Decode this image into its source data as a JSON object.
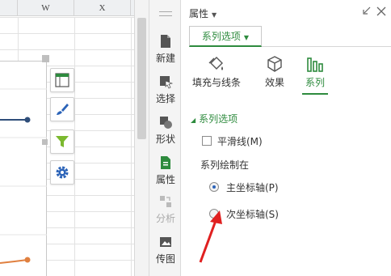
{
  "spreadsheet": {
    "columns": [
      "W",
      "X"
    ]
  },
  "chart_tools": [
    {
      "name": "chart-elements",
      "icon": "chart-elements-icon"
    },
    {
      "name": "chart-styles",
      "icon": "brush-icon"
    },
    {
      "name": "chart-filter",
      "icon": "funnel-icon"
    },
    {
      "name": "chart-settings",
      "icon": "gear-icon"
    }
  ],
  "sidebar": {
    "items": [
      {
        "label": "新建",
        "icon": "new-icon",
        "enabled": true
      },
      {
        "label": "选择",
        "icon": "select-icon",
        "enabled": true
      },
      {
        "label": "形状",
        "icon": "shape-icon",
        "enabled": true
      },
      {
        "label": "属性",
        "icon": "properties-icon",
        "enabled": true
      },
      {
        "label": "分析",
        "icon": "analysis-icon",
        "enabled": false
      },
      {
        "label": "传图",
        "icon": "upload-image-icon",
        "enabled": true
      }
    ]
  },
  "panel": {
    "title": "属性",
    "tab": "系列选项",
    "subtabs": [
      {
        "label": "填充与线条",
        "icon": "fill-bucket-icon"
      },
      {
        "label": "效果",
        "icon": "cube-icon"
      },
      {
        "label": "系列",
        "icon": "bar-series-icon",
        "active": true
      }
    ],
    "section_title": "系列选项",
    "smooth_line_label": "平滑线(M)",
    "smooth_line_checked": false,
    "plot_on_label": "系列绘制在",
    "radio_primary_label": "主坐标轴(P)",
    "radio_secondary_label": "次坐标轴(S)",
    "selected_axis": "primary"
  },
  "colors": {
    "accent_green": "#2e8b3e",
    "series_blue": "#2f4e7a",
    "series_orange": "#e08040",
    "annotation_red": "#e02020"
  }
}
